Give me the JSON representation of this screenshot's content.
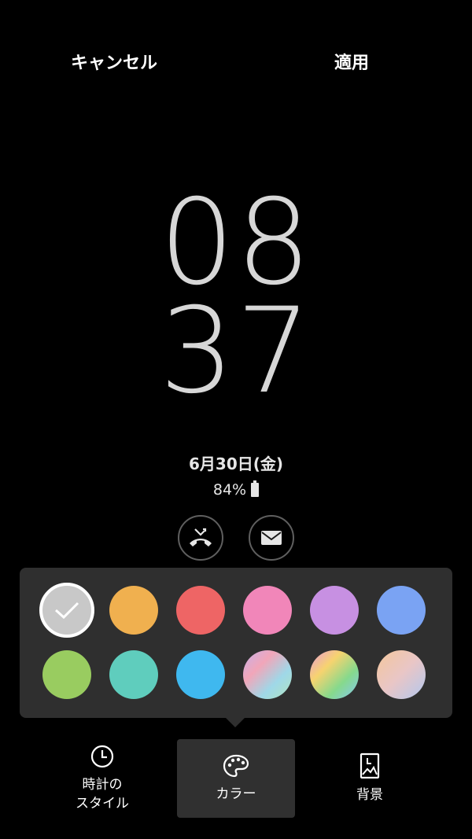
{
  "header": {
    "cancel_label": "キャンセル",
    "apply_label": "適用"
  },
  "clock": {
    "hour": "08",
    "minute": "37"
  },
  "status": {
    "date": "6月30日(金)",
    "battery": "84%"
  },
  "notifications": [
    {
      "icon": "missed-call-icon"
    },
    {
      "icon": "mail-icon"
    }
  ],
  "palette": {
    "colors": [
      {
        "name": "white",
        "fill": "#c8c8c8",
        "selected": true
      },
      {
        "name": "orange",
        "fill": "#f0b04f"
      },
      {
        "name": "red",
        "fill": "#ee6565"
      },
      {
        "name": "pink",
        "fill": "#f186b9"
      },
      {
        "name": "purple",
        "fill": "#c790e2"
      },
      {
        "name": "blue",
        "fill": "#7aa3f3"
      },
      {
        "name": "green",
        "fill": "#99cc60"
      },
      {
        "name": "teal",
        "fill": "#5fcdbd"
      },
      {
        "name": "sky-blue",
        "fill": "#3fb8ef"
      },
      {
        "name": "gradient-pastel",
        "fill": "linear-gradient(135deg,#c7b0e8,#f1a6b9,#9fd8e8,#b1e4c0)"
      },
      {
        "name": "gradient-rainbow",
        "fill": "linear-gradient(135deg,#e89ad8,#f7d36f,#86d98c,#86c8f1)"
      },
      {
        "name": "gradient-peach",
        "fill": "linear-gradient(135deg,#f4c79b,#e9c6c6,#b2c8ee)"
      }
    ]
  },
  "tabs": [
    {
      "icon": "clock-icon",
      "label": "時計の\nスタイル"
    },
    {
      "icon": "palette-icon",
      "label": "カラー"
    },
    {
      "icon": "wallpaper-icon",
      "label": "背景"
    }
  ]
}
